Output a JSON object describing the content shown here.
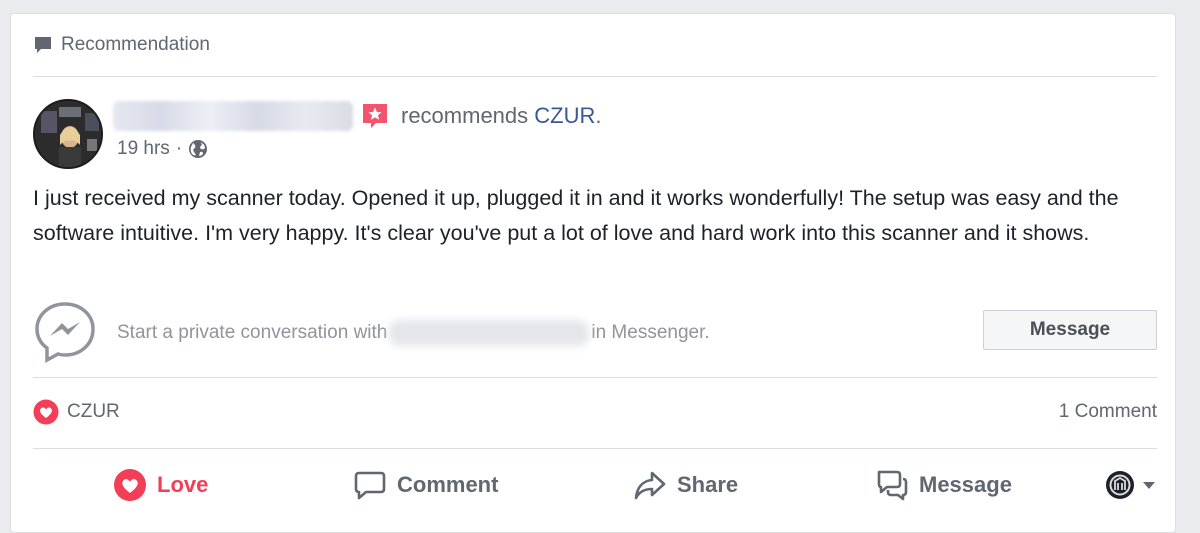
{
  "header": {
    "label": "Recommendation"
  },
  "post": {
    "recommends_text": "recommends",
    "page_name": "CZUR",
    "period": ".",
    "timestamp": "19 hrs",
    "separator": "·",
    "body": "I just received my scanner today. Opened it up, plugged it in and it works wonderfully! The setup was easy and the software intuitive. I'm very happy. It's clear you've put a lot of love and hard work into this scanner and it shows."
  },
  "messenger": {
    "prompt_start": "Start a private conversation with",
    "prompt_end": "in Messenger.",
    "button_label": "Message"
  },
  "stats": {
    "reactor": "CZUR",
    "comments": "1 Comment"
  },
  "actions": {
    "love": "Love",
    "comment": "Comment",
    "share": "Share",
    "message": "Message"
  },
  "colors": {
    "love": "#f33e58",
    "link": "#385898",
    "muted": "#606770",
    "badge": "#f2546e"
  }
}
